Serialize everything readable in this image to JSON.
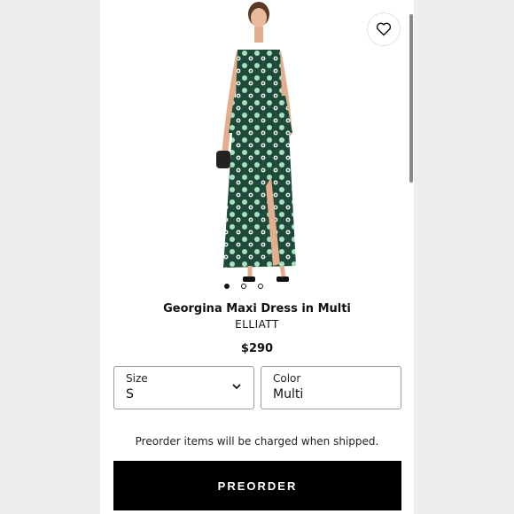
{
  "product": {
    "title": "Georgina Maxi Dress in Multi",
    "brand": "ELLIATT",
    "price": "$290",
    "image_count": 3,
    "active_image": 1
  },
  "size_select": {
    "label": "Size",
    "value": "S"
  },
  "color_select": {
    "label": "Color",
    "value": "Multi"
  },
  "notice": "Preorder items will be charged when shipped.",
  "preorder_button": "PREORDER",
  "icons": {
    "wishlist": "heart-icon",
    "dropdown": "chevron-down-icon"
  },
  "colors": {
    "button_bg": "#000000",
    "dress_green": "#1f4a3a",
    "dress_mint": "#a8e0c4"
  }
}
